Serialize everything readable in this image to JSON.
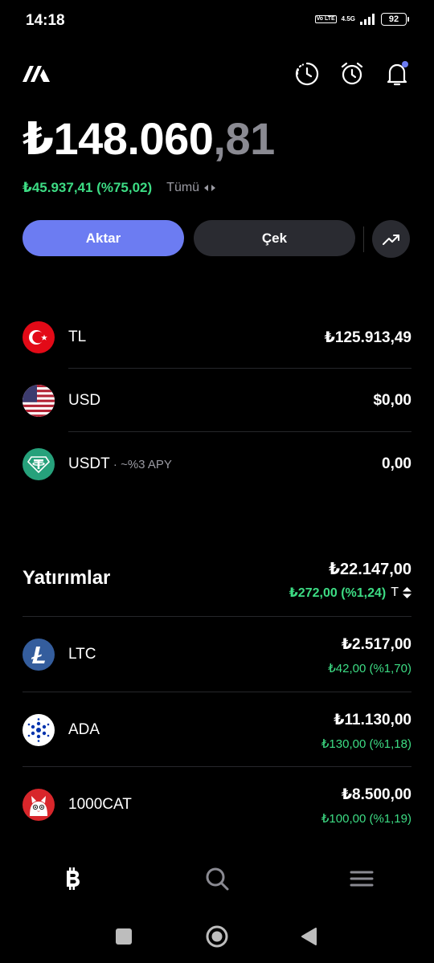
{
  "status_bar": {
    "time": "14:18",
    "volte": "Vo LTE",
    "network": "4.5G",
    "battery": "92"
  },
  "header": {
    "icons": [
      "logo-icon",
      "history-icon",
      "alarm-icon",
      "bell-icon"
    ]
  },
  "balance": {
    "main": "₺148.060",
    "decimals": ",81"
  },
  "pnl": {
    "value": "₺45.937,41 (%75,02)",
    "filter_label": "Tümü"
  },
  "actions": {
    "deposit_label": "Aktar",
    "withdraw_label": "Çek"
  },
  "accounts": [
    {
      "name": "TL",
      "value": "₺125.913,49",
      "icon": "turkey-flag-icon"
    },
    {
      "name": "USD",
      "value": "$0,00",
      "icon": "usa-flag-icon"
    },
    {
      "name": "USDT",
      "sub": " · ~%3 APY",
      "value": "0,00",
      "icon": "tether-icon"
    }
  ],
  "investments": {
    "title": "Yatırımlar",
    "total": "₺22.147,00",
    "change": "₺272,00 (%1,24)",
    "sort_label": "T",
    "items": [
      {
        "name": "LTC",
        "value": "₺2.517,00",
        "change": "₺42,00 (%1,70)",
        "icon": "litecoin-icon"
      },
      {
        "name": "ADA",
        "value": "₺11.130,00",
        "change": "₺130,00 (%1,18)",
        "icon": "cardano-icon"
      },
      {
        "name": "1000CAT",
        "value": "₺8.500,00",
        "change": "₺100,00 (%1,19)",
        "icon": "cat-icon"
      }
    ]
  },
  "colors": {
    "accent": "#6c7cf2",
    "positive": "#3ddc84",
    "surface": "#2a2b31",
    "background": "#000000"
  }
}
